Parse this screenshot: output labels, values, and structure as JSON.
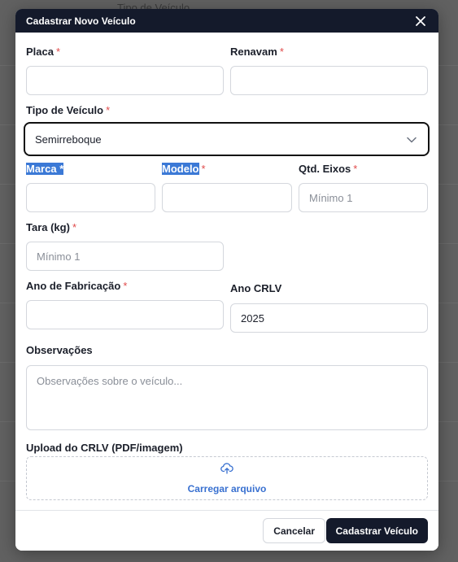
{
  "background": {
    "partial_text": "Tipo de Veículo"
  },
  "modal": {
    "title": "Cadastrar Novo Veículo",
    "close_icon": "close-icon"
  },
  "form": {
    "required_marker": "*",
    "placa": {
      "label": "Placa",
      "value": ""
    },
    "renavam": {
      "label": "Renavam",
      "value": ""
    },
    "tipo_veiculo": {
      "label": "Tipo de Veículo",
      "selected": "Semirreboque",
      "icon": "chevron-down-icon"
    },
    "marca": {
      "label": "Marca *",
      "value": ""
    },
    "modelo": {
      "label": "Modelo",
      "value": ""
    },
    "qtd_eixos": {
      "label": "Qtd. Eixos",
      "placeholder": "Mínimo 1"
    },
    "tara": {
      "label": "Tara (kg)",
      "placeholder": "Mínimo 1"
    },
    "ano_fabricacao": {
      "label": "Ano de Fabricação",
      "value": ""
    },
    "ano_crlv": {
      "label": "Ano CRLV",
      "value": "2025"
    },
    "observacoes": {
      "label": "Observações",
      "placeholder": "Observações sobre o veículo..."
    },
    "upload": {
      "label": "Upload do CRLV (PDF/imagem)",
      "button_text": "Carregar arquivo",
      "icon": "cloud-upload-icon"
    }
  },
  "footer": {
    "cancel_label": "Cancelar",
    "submit_label": "Cadastrar Veículo"
  },
  "colors": {
    "header_bg": "#141a2b",
    "required": "#e04a4a",
    "highlight": "#3b79d6",
    "link": "#3870d0"
  }
}
